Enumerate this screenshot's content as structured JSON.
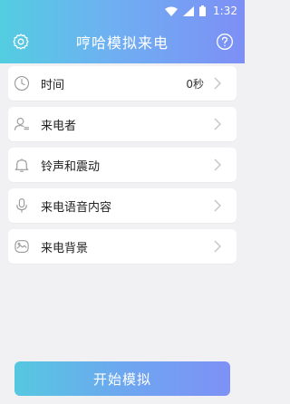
{
  "status_bar": {
    "time": "1:32",
    "icons": [
      "wifi-icon",
      "signal-icon",
      "battery-icon"
    ]
  },
  "header": {
    "title": "哼哈模拟来电",
    "left_icon": "gear-icon",
    "right_icon": "help-icon"
  },
  "settings": [
    {
      "icon": "clock-icon",
      "label": "时间",
      "value": "0秒"
    },
    {
      "icon": "person-icon",
      "label": "来电者",
      "value": ""
    },
    {
      "icon": "bell-icon",
      "label": "铃声和震动",
      "value": ""
    },
    {
      "icon": "microphone-icon",
      "label": "来电语音内容",
      "value": ""
    },
    {
      "icon": "image-icon",
      "label": "来电背景",
      "value": ""
    }
  ],
  "start_button": {
    "label": "开始模拟"
  },
  "colors": {
    "gradient_start": "#53cde0",
    "gradient_end": "#7d8ff5",
    "background": "#f1f1f3",
    "icon_gray": "#9a9a9a"
  }
}
